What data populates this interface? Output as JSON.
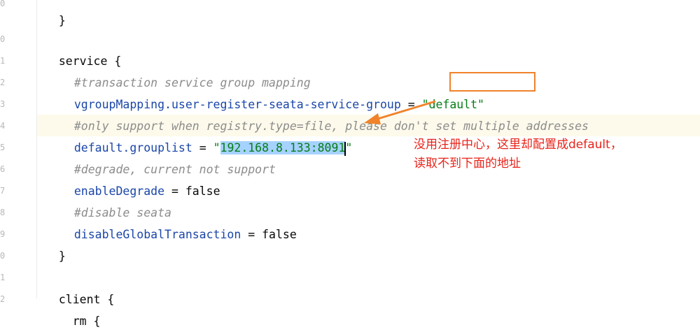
{
  "editor": {
    "gutter": [
      "0",
      "0",
      "1",
      "2",
      "3",
      "4",
      "5",
      "6",
      "7",
      "8",
      "9",
      "0",
      "1",
      "2"
    ],
    "lines": {
      "brace_close_top": "}",
      "service_open": "service {",
      "comment1": "#transaction service group mapping",
      "vgroup_key": "vgroupMapping.user-register-seata-service-group",
      "vgroup_eq": " = ",
      "vgroup_q1": "\"",
      "vgroup_val": "default\"",
      "comment2": "#only support when registry.type=file, please don't set multiple addresses",
      "grouplist_key": "default.grouplist",
      "grouplist_eq": " = ",
      "grouplist_q1": "\"",
      "grouplist_val": "192.168.8.133:8091",
      "grouplist_q2": "\"",
      "comment3": "#degrade, current not support",
      "degrade_key": "enableDegrade",
      "degrade_eq": " = ",
      "degrade_val": "false",
      "comment4": "#disable seata",
      "disable_key": "disableGlobalTransaction",
      "disable_eq": " = ",
      "disable_val": "false",
      "service_close": "}",
      "client_open": "client {",
      "rm_open": "  rm {"
    }
  },
  "annotation": {
    "line1": "没用注册中心，这里却配置成default，",
    "line2": "读取不到下面的地址",
    "box_color": "#f0832b",
    "arrow_color": "#f0832b",
    "text_color": "#e8231a"
  }
}
